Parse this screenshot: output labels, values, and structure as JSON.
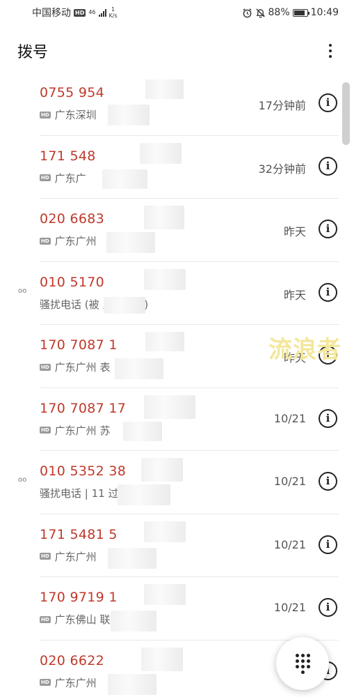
{
  "status_bar": {
    "carrier": "中国移动",
    "hd": "HD",
    "network": "46",
    "speed_value": "1",
    "speed_unit": "K/s",
    "battery": "88%",
    "time": "10:49",
    "icons": [
      "alarm-icon",
      "mute-bell-icon",
      "battery-icon",
      "signal-icon"
    ]
  },
  "header": {
    "title": "拨号",
    "menu_icon": "more-vertical-icon"
  },
  "calls": [
    {
      "number": "0755 954",
      "sub": "广东深圳",
      "time": "17分钟前",
      "hd": "HD",
      "voicemail": ""
    },
    {
      "number": "171 548",
      "sub": "广东广",
      "time": "32分钟前",
      "hd": "HD",
      "voicemail": ""
    },
    {
      "number": "020 6683",
      "sub": "广东广州",
      "time": "昨天",
      "hd": "HD",
      "voicemail": ""
    },
    {
      "number": "010 5170",
      "sub": "骚扰电话 (被 人标记过)",
      "time": "昨天",
      "hd": "",
      "voicemail": "oo"
    },
    {
      "number": "170 7087 1",
      "sub": "广东广州 表",
      "time": "昨天",
      "hd": "HD",
      "voicemail": ""
    },
    {
      "number": "170 7087 17",
      "sub": "广东广州 苏",
      "time": "10/21",
      "hd": "HD",
      "voicemail": ""
    },
    {
      "number": "010 5352 38",
      "sub": "骚扰电话 | 11 过",
      "time": "10/21",
      "hd": "",
      "voicemail": "oo"
    },
    {
      "number": "171 5481 5",
      "sub": "广东广州",
      "time": "10/21",
      "hd": "HD",
      "voicemail": ""
    },
    {
      "number": "170 9719 1",
      "sub": "广东佛山 联",
      "time": "10/21",
      "hd": "HD",
      "voicemail": ""
    },
    {
      "number": "020 6622",
      "sub": "广东广州",
      "time": "",
      "hd": "HD",
      "voicemail": ""
    }
  ],
  "info_glyph": "i",
  "watermark": "流浪者",
  "fab": {
    "icon": "dialpad-icon"
  },
  "colors": {
    "number": "#c0392b",
    "watermark": "#f3e79c"
  }
}
